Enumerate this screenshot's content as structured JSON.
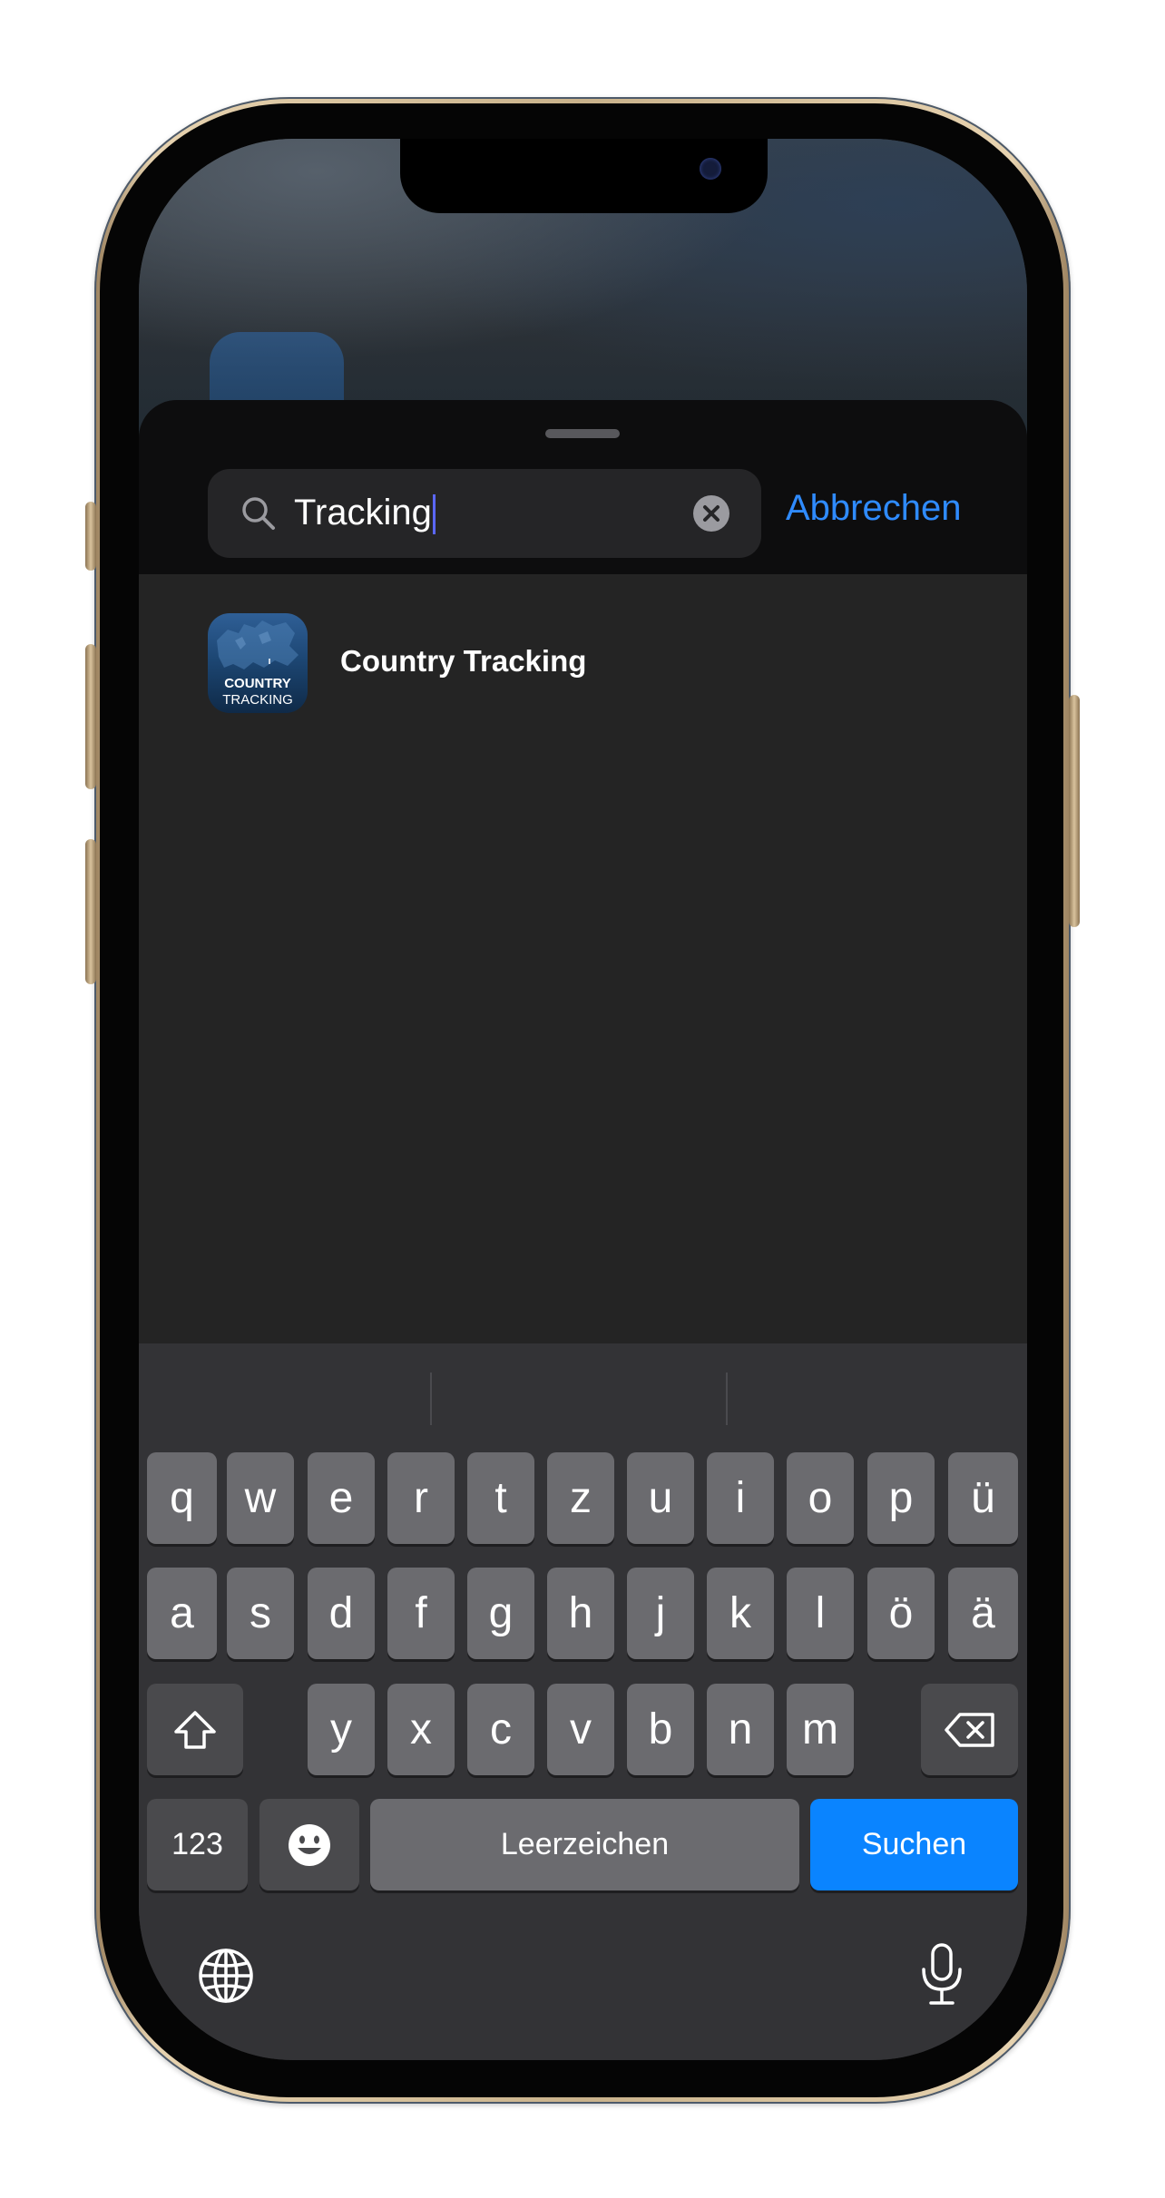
{
  "search": {
    "query": "Tracking",
    "cancel_label": "Abbrechen"
  },
  "results": [
    {
      "name": "Country Tracking",
      "icon_lines": [
        "COUNTRY",
        "TRACKING"
      ]
    }
  ],
  "keyboard": {
    "row1": [
      "q",
      "w",
      "e",
      "r",
      "t",
      "z",
      "u",
      "i",
      "o",
      "p",
      "ü"
    ],
    "row2": [
      "a",
      "s",
      "d",
      "f",
      "g",
      "h",
      "j",
      "k",
      "l",
      "ö",
      "ä"
    ],
    "row3": [
      "y",
      "x",
      "c",
      "v",
      "b",
      "n",
      "m"
    ],
    "numbers_label": "123",
    "space_label": "Leerzeichen",
    "return_label": "Suchen"
  },
  "colors": {
    "accent": "#2f8bff",
    "return_key": "#0a84ff"
  },
  "icons": [
    "search-icon",
    "clear-icon",
    "shift-icon",
    "delete-icon",
    "emoji-icon",
    "globe-icon",
    "microphone-icon"
  ]
}
